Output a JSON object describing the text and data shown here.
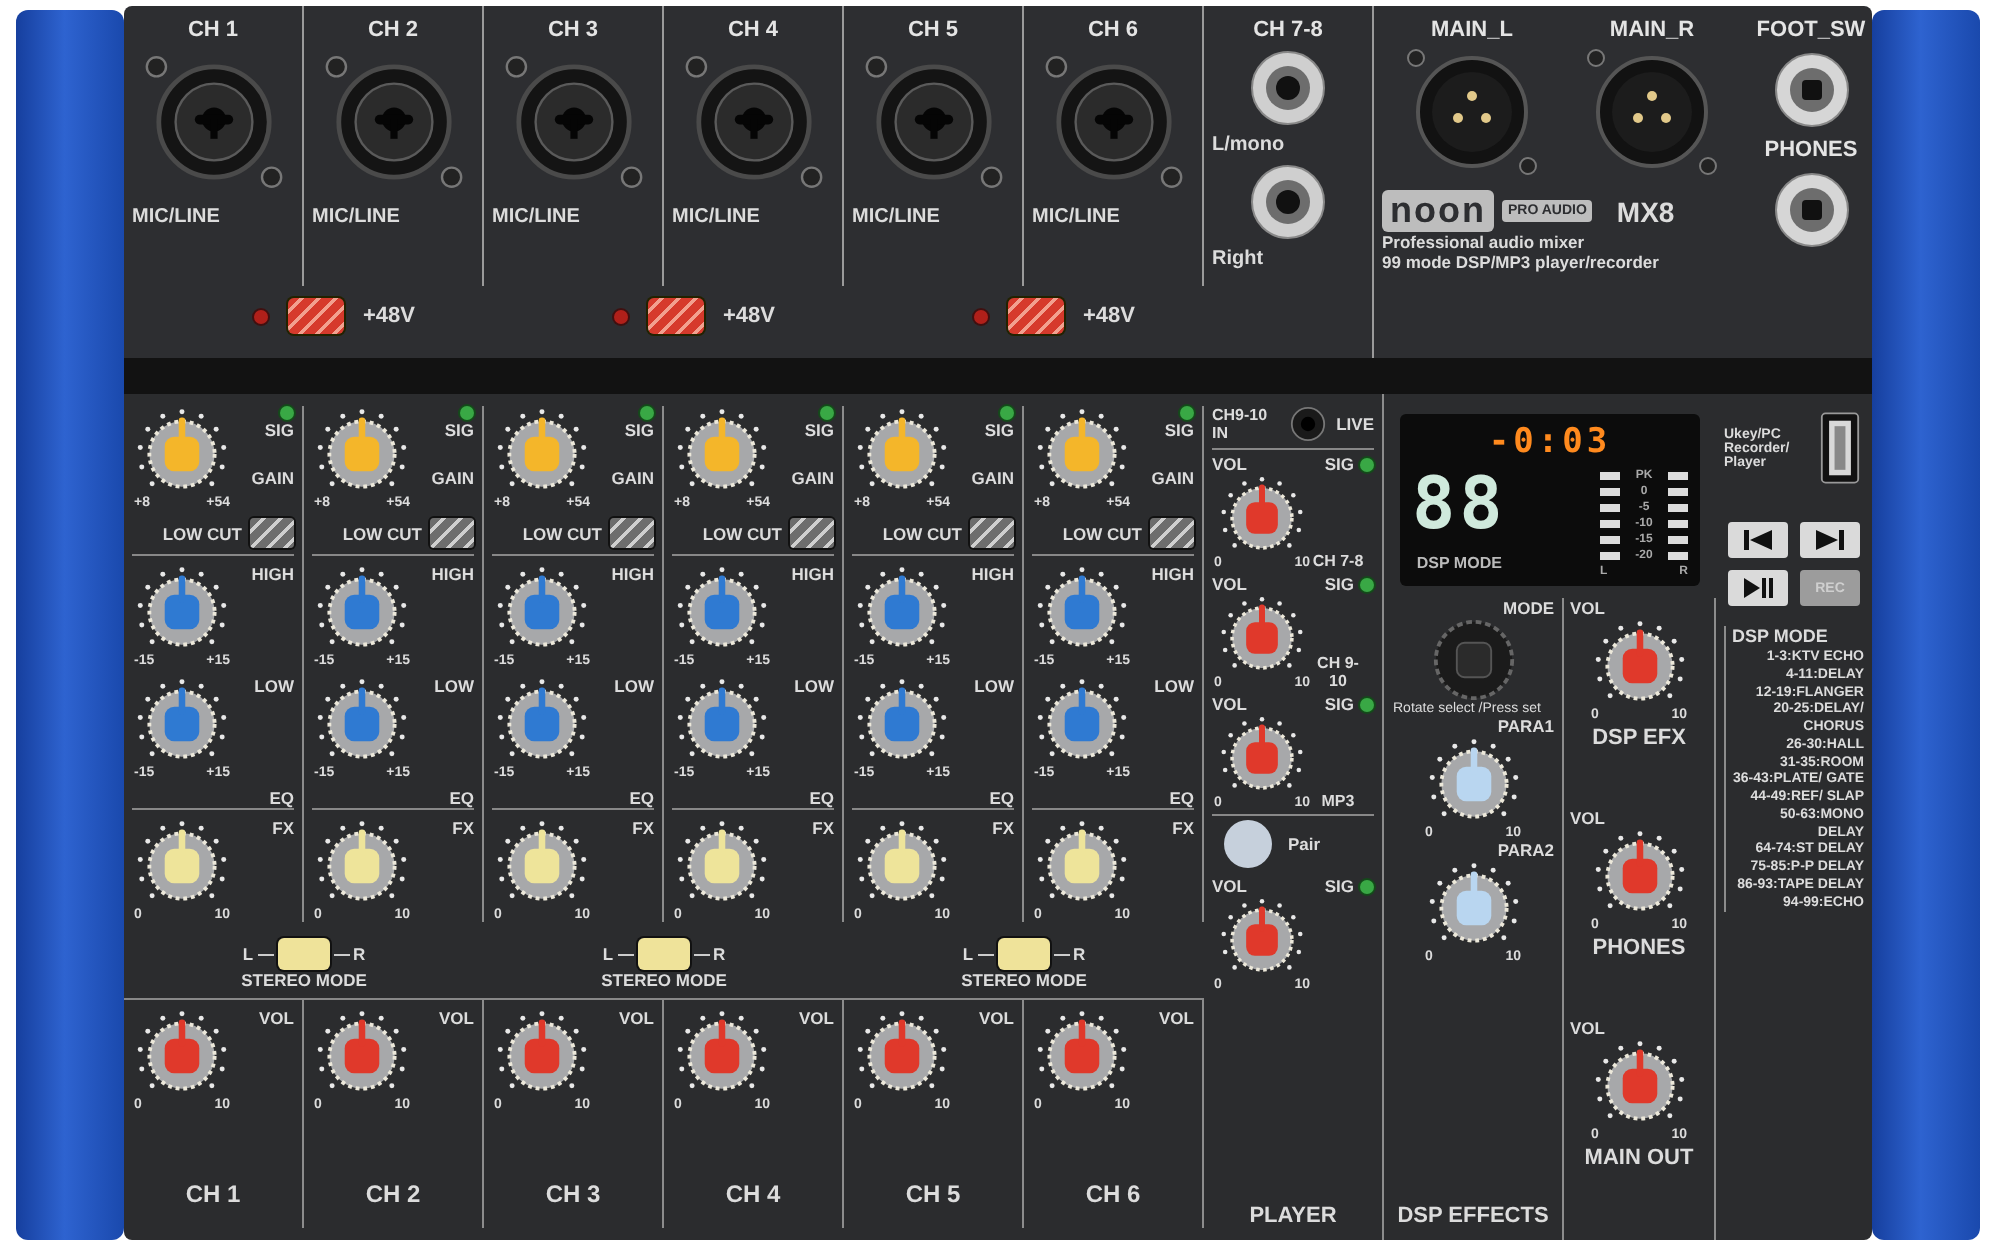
{
  "inputs": [
    {
      "channels": [
        {
          "label": "CH 1",
          "jack_label": "MIC/LINE"
        },
        {
          "label": "CH 2",
          "jack_label": "MIC/LINE"
        }
      ],
      "phantom": {
        "label": "+48V",
        "on": true
      }
    },
    {
      "channels": [
        {
          "label": "CH 3",
          "jack_label": "MIC/LINE"
        },
        {
          "label": "CH 4",
          "jack_label": "MIC/LINE"
        }
      ],
      "phantom": {
        "label": "+48V",
        "on": true
      }
    },
    {
      "channels": [
        {
          "label": "CH 5",
          "jack_label": "MIC/LINE"
        },
        {
          "label": "CH 6",
          "jack_label": "MIC/LINE"
        }
      ],
      "phantom": {
        "label": "+48V",
        "on": true
      }
    }
  ],
  "ch78": {
    "label": "CH 7-8",
    "left": "L/mono",
    "right": "Right"
  },
  "main_outs": [
    {
      "label": "MAIN_L"
    },
    {
      "label": "MAIN_R"
    }
  ],
  "logo": {
    "brand": "noon",
    "sub": "PRO AUDIO",
    "model": "MX8"
  },
  "tagline": [
    "Professional audio mixer",
    "99 mode DSP/MP3 player/recorder"
  ],
  "foot": {
    "foot_sw": "FOOT_SW",
    "phones": "PHONES"
  },
  "pairs": [
    {
      "strips": [
        {
          "sig": "SIG",
          "gain": {
            "label": "GAIN",
            "min": "+8",
            "max": "+54"
          },
          "low_cut": {
            "label": "LOW CUT",
            "on": false
          },
          "high": {
            "label": "HIGH",
            "min": "-15",
            "max": "+15"
          },
          "low": {
            "label": "LOW",
            "min": "-15",
            "max": "+15"
          },
          "eq": "EQ",
          "fx": {
            "label": "FX",
            "min": "0",
            "max": "10"
          },
          "vol": {
            "label": "VOL",
            "min": "0",
            "max": "10"
          },
          "name": "CH 1"
        },
        {
          "sig": "SIG",
          "gain": {
            "label": "GAIN",
            "min": "+8",
            "max": "+54"
          },
          "low_cut": {
            "label": "LOW CUT",
            "on": false
          },
          "high": {
            "label": "HIGH",
            "min": "-15",
            "max": "+15"
          },
          "low": {
            "label": "LOW",
            "min": "-15",
            "max": "+15"
          },
          "eq": "EQ",
          "fx": {
            "label": "FX",
            "min": "0",
            "max": "10"
          },
          "vol": {
            "label": "VOL",
            "min": "0",
            "max": "10"
          },
          "name": "CH 2"
        }
      ],
      "stereo": {
        "left": "L",
        "right": "R",
        "label": "STEREO MODE",
        "on": true
      }
    },
    {
      "strips": [
        {
          "sig": "SIG",
          "gain": {
            "label": "GAIN",
            "min": "+8",
            "max": "+54"
          },
          "low_cut": {
            "label": "LOW CUT",
            "on": false
          },
          "high": {
            "label": "HIGH",
            "min": "-15",
            "max": "+15"
          },
          "low": {
            "label": "LOW",
            "min": "-15",
            "max": "+15"
          },
          "eq": "EQ",
          "fx": {
            "label": "FX",
            "min": "0",
            "max": "10"
          },
          "vol": {
            "label": "VOL",
            "min": "0",
            "max": "10"
          },
          "name": "CH 3"
        },
        {
          "sig": "SIG",
          "gain": {
            "label": "GAIN",
            "min": "+8",
            "max": "+54"
          },
          "low_cut": {
            "label": "LOW CUT",
            "on": false
          },
          "high": {
            "label": "HIGH",
            "min": "-15",
            "max": "+15"
          },
          "low": {
            "label": "LOW",
            "min": "-15",
            "max": "+15"
          },
          "eq": "EQ",
          "fx": {
            "label": "FX",
            "min": "0",
            "max": "10"
          },
          "vol": {
            "label": "VOL",
            "min": "0",
            "max": "10"
          },
          "name": "CH 4"
        }
      ],
      "stereo": {
        "left": "L",
        "right": "R",
        "label": "STEREO MODE",
        "on": true
      }
    },
    {
      "strips": [
        {
          "sig": "SIG",
          "gain": {
            "label": "GAIN",
            "min": "+8",
            "max": "+54"
          },
          "low_cut": {
            "label": "LOW CUT",
            "on": false
          },
          "high": {
            "label": "HIGH",
            "min": "-15",
            "max": "+15"
          },
          "low": {
            "label": "LOW",
            "min": "-15",
            "max": "+15"
          },
          "eq": "EQ",
          "fx": {
            "label": "FX",
            "min": "0",
            "max": "10"
          },
          "vol": {
            "label": "VOL",
            "min": "0",
            "max": "10"
          },
          "name": "CH 5"
        },
        {
          "sig": "SIG",
          "gain": {
            "label": "GAIN",
            "min": "+8",
            "max": "+54"
          },
          "low_cut": {
            "label": "LOW CUT",
            "on": false
          },
          "high": {
            "label": "HIGH",
            "min": "-15",
            "max": "+15"
          },
          "low": {
            "label": "LOW",
            "min": "-15",
            "max": "+15"
          },
          "eq": "EQ",
          "fx": {
            "label": "FX",
            "min": "0",
            "max": "10"
          },
          "vol": {
            "label": "VOL",
            "min": "0",
            "max": "10"
          },
          "name": "CH 6"
        }
      ],
      "stereo": {
        "left": "L",
        "right": "R",
        "label": "STEREO MODE",
        "on": true
      }
    }
  ],
  "player": {
    "input_label": "CH9-10 IN",
    "live": "LIVE",
    "rows": [
      {
        "kind": "knob",
        "vol": "VOL",
        "sig": "SIG",
        "name": "CH 7-8",
        "min": "0",
        "max": "10"
      },
      {
        "kind": "knob",
        "vol": "VOL",
        "sig": "SIG",
        "name": "CH 9-10",
        "min": "0",
        "max": "10"
      },
      {
        "kind": "knob",
        "vol": "VOL",
        "sig": "SIG",
        "name": "MP3",
        "min": "0",
        "max": "10"
      },
      {
        "kind": "pair",
        "label": "Pair"
      },
      {
        "kind": "knob",
        "vol": "VOL",
        "sig": "SIG",
        "min": "0",
        "max": "10"
      }
    ],
    "title": "PLAYER"
  },
  "display": {
    "time": "-0:03",
    "mode_number": "88",
    "mode_label": "DSP MODE",
    "meter_labels": [
      "PK",
      "0",
      "-5",
      "-10",
      "-15",
      "-20"
    ],
    "left": "L",
    "right": "R"
  },
  "dsp": {
    "mode": "MODE",
    "hint": "Rotate select /Press set",
    "knobs": [
      {
        "label": "PARA1",
        "min": "0",
        "max": "10"
      },
      {
        "label": "PARA2",
        "min": "0",
        "max": "10"
      }
    ],
    "title": "DSP EFFECTS"
  },
  "main_out": {
    "rows": [
      {
        "vol": "VOL",
        "min": "0",
        "max": "10",
        "name": "DSP EFX"
      },
      {
        "vol": "VOL",
        "min": "0",
        "max": "10",
        "name": "PHONES"
      },
      {
        "vol": "VOL",
        "min": "0",
        "max": "10",
        "name": "MAIN OUT"
      }
    ]
  },
  "usb": {
    "label": "Ukey/PC Recorder/ Player"
  },
  "transport": [
    {
      "kind": "prev"
    },
    {
      "kind": "next"
    },
    {
      "kind": "play_pause"
    },
    {
      "kind": "rec",
      "label": "REC"
    }
  ],
  "dsp_modes": {
    "title": "DSP MODE",
    "items": [
      "1-3:KTV ECHO",
      "4-11:DELAY",
      "12-19:FLANGER",
      "20-25:DELAY/ CHORUS",
      "26-30:HALL",
      "31-35:ROOM",
      "36-43:PLATE/ GATE",
      "44-49:REF/ SLAP",
      "50-63:MONO DELAY",
      "64-74:ST DELAY",
      "75-85:P-P DELAY",
      "86-93:TAPE DELAY",
      "94-99:ECHO"
    ]
  }
}
